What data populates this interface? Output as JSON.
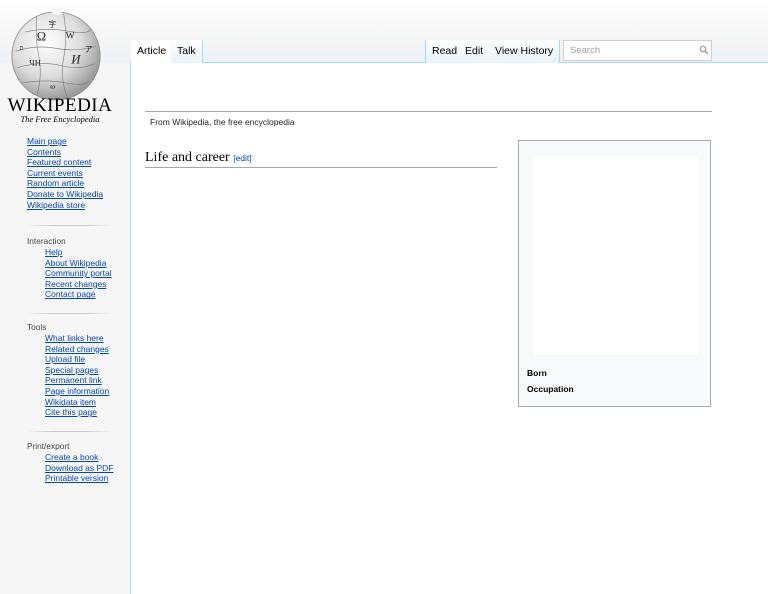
{
  "logo": {
    "wordmark": "WIKIPEDIA",
    "tagline": "The Free Encyclopedia"
  },
  "sidebar": {
    "main": [
      "Main page",
      "Contents",
      "Featured content",
      "Current events",
      "Random article",
      "Donate to Wikipedia",
      "Wikipedia store"
    ],
    "interaction": {
      "heading": "Interaction",
      "items": [
        "Help",
        "About Wikipedia",
        "Community portal",
        "Recent changes",
        "Contact page"
      ]
    },
    "tools": {
      "heading": "Tools",
      "items": [
        "What links here",
        "Related changes",
        "Upload file",
        "Special pages",
        "Permanent link",
        "Page information",
        "Wikidata item",
        "Cite this page"
      ]
    },
    "print": {
      "heading": "Print/export",
      "items": [
        "Create a book",
        "Download as PDF",
        "Printable version"
      ]
    }
  },
  "tabs": {
    "article": "Article",
    "talk": "Talk",
    "read": "Read",
    "edit": "Edit",
    "history": "View History"
  },
  "search": {
    "placeholder": "Search",
    "icon": "magnifier-icon"
  },
  "article": {
    "tagline": "From Wikipedia, the free encyclopedia",
    "section_heading": "Life and career",
    "section_edit": "[edit]"
  },
  "infobox": {
    "born_label": "Born",
    "occupation_label": "Occupation"
  },
  "colors": {
    "link": "#0645ad",
    "border": "#a7d7f9",
    "rule": "#a2a9b1"
  }
}
